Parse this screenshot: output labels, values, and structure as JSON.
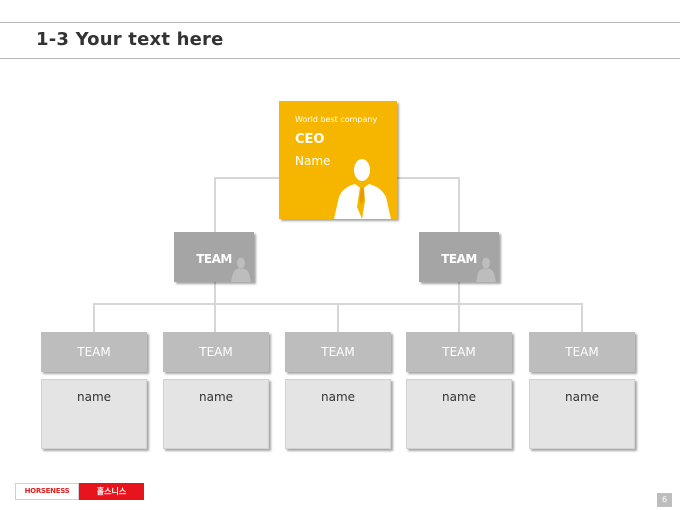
{
  "header": {
    "title": "1-3 Your text here"
  },
  "ceo": {
    "tagline": "World best company",
    "role": "CEO",
    "name": "Name"
  },
  "teams": [
    {
      "label": "TEAM"
    },
    {
      "label": "TEAM"
    }
  ],
  "subteams": [
    {
      "label": "TEAM",
      "name": "name"
    },
    {
      "label": "TEAM",
      "name": "name"
    },
    {
      "label": "TEAM",
      "name": "name"
    },
    {
      "label": "TEAM",
      "name": "name"
    },
    {
      "label": "TEAM",
      "name": "name"
    }
  ],
  "footer": {
    "brand_en": "HORSENESS",
    "brand_kr": "홀스니스",
    "page_number": "6"
  },
  "colors": {
    "accent": "#f6b600",
    "team": "#a5a5a5",
    "subteam_head": "#bdbdbd",
    "subteam_body": "#e4e4e4",
    "brand_red": "#e8141c"
  }
}
